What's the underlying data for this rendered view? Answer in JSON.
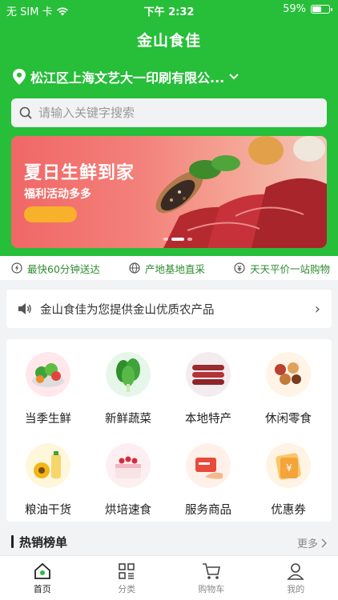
{
  "status_bar": {
    "carrier": "无 SIM 卡",
    "time": "下午 2:32",
    "battery": "59%",
    "battery_level": 0.59
  },
  "app": {
    "title": "金山食佳"
  },
  "location": {
    "address": "松江区上海文艺大一印刷有限公..."
  },
  "search": {
    "placeholder": "请输入关键字搜索"
  },
  "banner": {
    "headline": "夏日生鲜到家",
    "subtext": "福利活动多多",
    "slide_count": 3,
    "active_slide": 1
  },
  "features": [
    {
      "label": "最快60分钟送达",
      "icon": "lightning-icon"
    },
    {
      "label": "产地基地直采",
      "icon": "globe-icon"
    },
    {
      "label": "天天平价一站购物",
      "icon": "coin-icon"
    }
  ],
  "notice": {
    "text": "金山食佳为您提供金山优质农产品",
    "icon": "speaker-icon"
  },
  "categories": [
    {
      "label": "当季生鲜",
      "icon": "fresh-produce-icon"
    },
    {
      "label": "新鲜蔬菜",
      "icon": "vegetables-icon"
    },
    {
      "label": "本地特产",
      "icon": "sausage-icon"
    },
    {
      "label": "休闲零食",
      "icon": "snacks-icon"
    },
    {
      "label": "粮油干货",
      "icon": "oil-grain-icon"
    },
    {
      "label": "烘培速食",
      "icon": "cake-icon"
    },
    {
      "label": "服务商品",
      "icon": "service-card-icon"
    },
    {
      "label": "优惠券",
      "icon": "coupon-icon"
    }
  ],
  "hot_list": {
    "title": "热销榜单",
    "more": "更多"
  },
  "tabbar": [
    {
      "label": "首页",
      "icon": "home-icon",
      "active": true
    },
    {
      "label": "分类",
      "icon": "grid-icon",
      "active": false
    },
    {
      "label": "购物车",
      "icon": "cart-icon",
      "active": false
    },
    {
      "label": "我的",
      "icon": "user-icon",
      "active": false
    }
  ],
  "colors": {
    "brand_green": "#27be39",
    "banner_accent": "#f8b12a",
    "feature_text": "#2e8b2e"
  }
}
